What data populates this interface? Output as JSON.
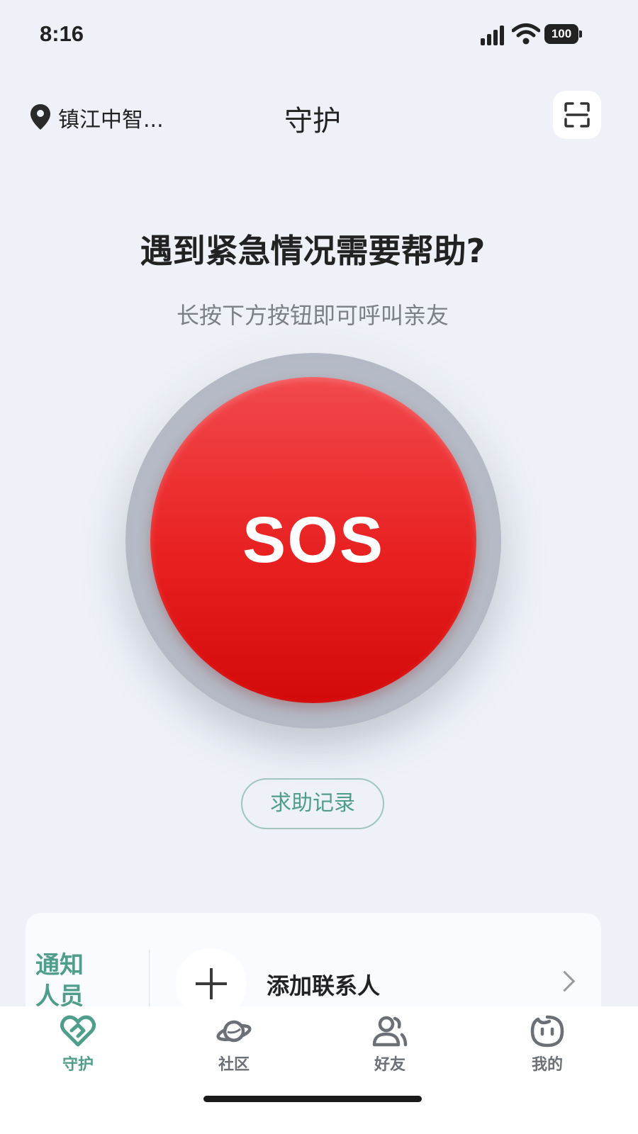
{
  "status_bar": {
    "time": "8:16",
    "battery": "100"
  },
  "header": {
    "location": "镇江中智...",
    "title": "守护"
  },
  "main": {
    "headline": "遇到紧急情况需要帮助?",
    "subhead": "长按下方按钮即可呼叫亲友",
    "sos_label": "SOS",
    "record_label": "求助记录"
  },
  "notify": {
    "label": "通知人员",
    "add_contact": "添加联系人"
  },
  "tabs": [
    {
      "label": "守护",
      "icon": "heart-icon",
      "active": true
    },
    {
      "label": "社区",
      "icon": "planet-icon",
      "active": false
    },
    {
      "label": "好友",
      "icon": "friends-icon",
      "active": false
    },
    {
      "label": "我的",
      "icon": "face-icon",
      "active": false
    }
  ],
  "colors": {
    "accent": "#4f9e8b",
    "sos": "#e82020",
    "background": "#eef1f8"
  }
}
